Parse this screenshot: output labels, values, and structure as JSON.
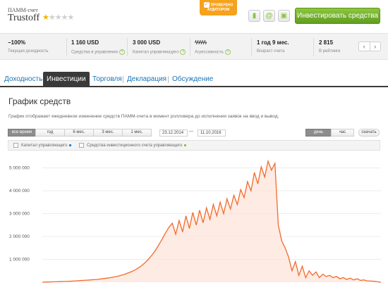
{
  "header": {
    "account_type": "ПАММ-счет",
    "account_name": "Trustoff",
    "stars_filled": 1,
    "stars_total": 5,
    "audit_badge": "ПРОВЕРЕНО АУДИТОРОМ",
    "invest_button": "Инвестировать средства",
    "icons": [
      "bookmark-icon",
      "at-icon",
      "briefcase-icon"
    ]
  },
  "stats": [
    {
      "value": "−100%",
      "label": "Текущая доходность"
    },
    {
      "value": "1 160 USD",
      "label": "Средства в управлении"
    },
    {
      "value": "3 000 USD",
      "label": "Капитал управляющего"
    },
    {
      "value": "ϟϟϟϟϟ",
      "label": "Агрессивность"
    },
    {
      "value": "1 год 9 мес.",
      "label": "Возраст счета"
    },
    {
      "value": "2 815",
      "label": "В рейтинге"
    }
  ],
  "pager": {
    "prev": "‹",
    "next": "›"
  },
  "tabs": [
    {
      "label": "Доходность",
      "active": false
    },
    {
      "label": "Инвестиции",
      "active": true
    },
    {
      "label": "Торговля",
      "active": false
    },
    {
      "label": "Декларация",
      "active": false
    },
    {
      "label": "Обсуждение",
      "active": false
    }
  ],
  "section": {
    "title": "График средств",
    "description": "График отображает ежедневное изменение средств ПАММ-счета в момент ролловера до исполнения заявок на ввод и вывод."
  },
  "controls": {
    "ranges": [
      "все время",
      "год",
      "6 мес.",
      "3 мес.",
      "1 мес."
    ],
    "active_range": "все время",
    "date_from": "23.12.2014",
    "date_to": "11.10.2016",
    "granularity": [
      "день",
      "час"
    ],
    "active_granularity": "день",
    "download": "скачать"
  },
  "legend": [
    {
      "label": "Капитал управляющего",
      "color": "#1e88e5"
    },
    {
      "label": "Средства инвестиционного счета управляющего",
      "color": "#8bc34a"
    }
  ],
  "chart_data": {
    "type": "area",
    "color": "#f26b2a",
    "fill": "#fde3d8",
    "y_ticks": [
      1000000,
      2000000,
      3000000,
      4000000,
      5000000
    ],
    "y_tick_labels": [
      "1 000 000",
      "2 000 000",
      "3 000 000",
      "4 000 000",
      "5 000 000"
    ],
    "ylim": [
      0,
      5450000
    ],
    "x_range": [
      "23.12.2014",
      "11.10.2016"
    ],
    "series": [
      {
        "values": [
          0,
          5000,
          10000,
          15000,
          20000,
          25000,
          30000,
          35000,
          40000,
          50000,
          60000,
          70000,
          80000,
          90000,
          100000,
          110000,
          120000,
          140000,
          160000,
          180000,
          200000,
          230000,
          260000,
          300000,
          340000,
          400000,
          460000,
          530000,
          620000,
          720000,
          850000,
          1000000,
          1180000,
          1380000,
          1620000,
          1880000,
          2150000,
          2400000,
          2580000,
          2100000,
          2700000,
          2200000,
          2900000,
          2350000,
          3050000,
          2500000,
          3150000,
          2600000,
          3250000,
          2750000,
          3400000,
          2900000,
          3500000,
          3000000,
          3650000,
          3200000,
          3800000,
          3400000,
          4050000,
          3700000,
          4400000,
          4000000,
          4800000,
          4300000,
          5050000,
          4600000,
          5300000,
          4900000,
          5200000,
          2500000,
          1800000,
          1500000,
          1100000,
          500000,
          900000,
          300000,
          700000,
          200000,
          500000,
          300000,
          450000,
          200000,
          350000,
          250000,
          300000,
          200000,
          250000,
          150000,
          200000,
          120000,
          180000,
          100000,
          150000,
          80000,
          100000,
          60000,
          50000,
          40000,
          20000,
          0
        ]
      }
    ]
  }
}
